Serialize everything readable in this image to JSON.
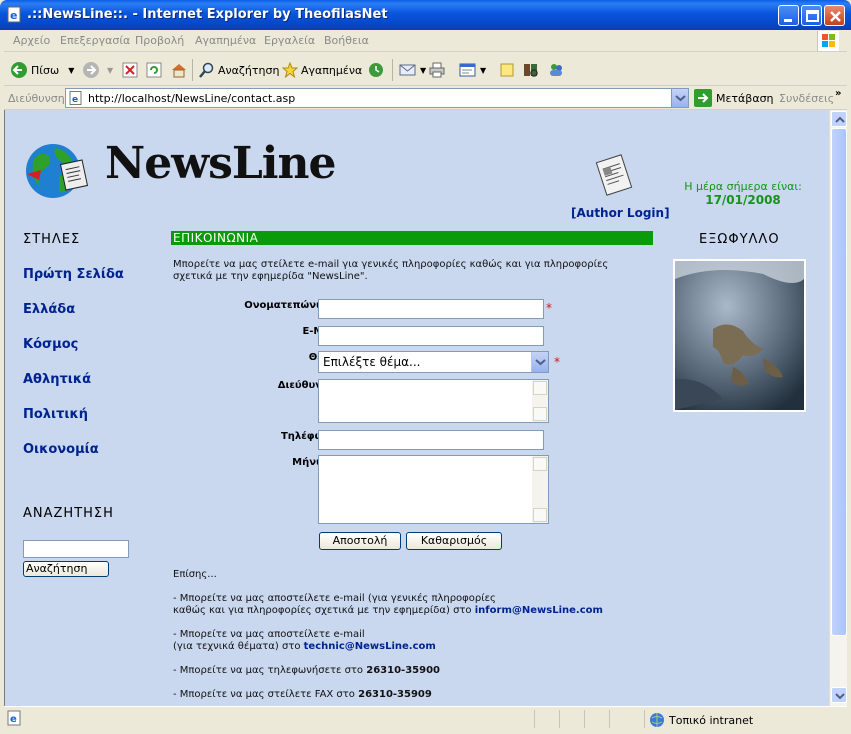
{
  "window": {
    "title": ".::NewsLine::. - Internet Explorer by TheofilasNet"
  },
  "menu": [
    "Αρχείο",
    "Επεξεργασία",
    "Προβολή",
    "Αγαπημένα",
    "Εργαλεία",
    "Βοήθεια"
  ],
  "toolbar": {
    "back_label": "Πίσω",
    "search_label": "Αναζήτηση",
    "favorites_label": "Αγαπημένα"
  },
  "address": {
    "label": "Διεύθυνση",
    "url": "http://localhost/NewsLine/contact.asp",
    "go_label": "Μετάβαση",
    "links_label": "Συνδέσεις"
  },
  "page": {
    "logo_text": "NewsLine",
    "author_login": "[Author Login]",
    "date_label": "Η μέρα σήμερα είναι:",
    "date_value": "17/01/2008",
    "nav_header": "ΣΤΗΛΕΣ",
    "nav_items": [
      "Πρώτη Σελίδα",
      "Ελλάδα",
      "Κόσμος",
      "Αθλητικά",
      "Πολιτική",
      "Οικονομία"
    ],
    "search_header": "ΑΝΑΖΗΤΗΣΗ",
    "search_value": "",
    "search_button": "Αναζήτηση",
    "cover_header": "ΕΞΩΦΥΛΛΟ",
    "section_title": "ΕΠΙΚΟΙΝΩΝΙΑ",
    "intro_line1": "Μπορείτε να μας στείλετε e-mail για γενικές πληροφορίες καθώς και για πληροφορίες",
    "intro_line2": "σχετικά με την εφημερίδα \"NewsLine\".",
    "form": {
      "name_label": "Ονοματεπώνυμο:",
      "email_label": "E-Mail:",
      "subject_label": "Θέμα:",
      "subject_value": "Επιλέξτε θέμα...",
      "address_label": "Διεύθυνση:",
      "phone_label": "Τηλέφωνο:",
      "message_label": "Μήνυμα:",
      "required_mark": "*",
      "submit_label": "Αποστολή",
      "reset_label": "Καθαρισμός"
    },
    "info": {
      "also": "Επίσης...",
      "general_line1": "- Μπορείτε να μας αποστείλετε e-mail (για γενικές πληροφορίες",
      "general_line2": "καθώς και για πληροφορίες σχετικά με την εφημερίδα) στο",
      "general_email": "inform@NewsLine.com",
      "tech_line1": "- Μπορείτε να μας αποστείλετε e-mail",
      "tech_line2": "(για τεχνικά θέματα) στο",
      "tech_email": "technic@NewsLine.com",
      "phone_text": "- Μπορείτε να μας τηλεφωνήσετε στο",
      "phone_number": "26310-35900",
      "fax_text": "- Μπορείτε να μας στείλετε FAX στο",
      "fax_number": "26310-35909"
    }
  },
  "status": {
    "zone": "Τοπικό intranet"
  },
  "colors": {
    "page_bg": "#c9d7ef",
    "nav_link": "#00248f",
    "section_bar": "#0a9a0a",
    "date_text": "#14941a"
  }
}
